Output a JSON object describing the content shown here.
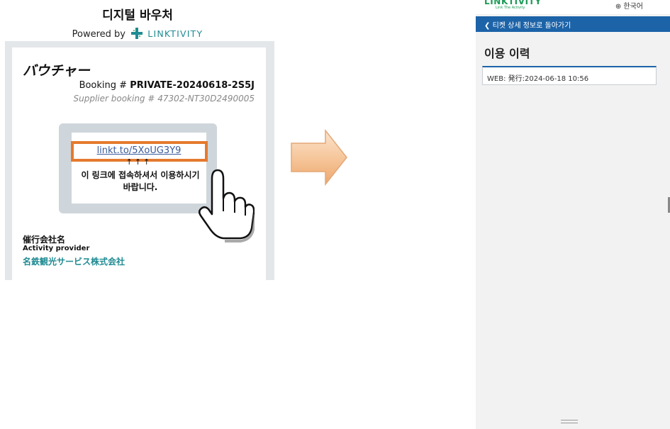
{
  "voucher": {
    "title": "디지털 바우처",
    "powered_by": "Powered by",
    "brand": "LINKTIVITY",
    "heading": "バウチャー",
    "booking_prefix": "Booking # ",
    "booking_number": "PRIVATE-20240618-2S5J",
    "supplier_booking": "Supplier booking # 47302-NT30D2490005",
    "link": "linkt.to/5XoUG3Y9",
    "arrows": "↑↑↑",
    "access_message": "이 링크에 접속하셔서 이용하시기 바랍니다.",
    "organizer_label": "催行会社名",
    "provider_label": "Activity provider",
    "provider_name": "名鉄観光サービス株式会社"
  },
  "phone": {
    "logo": "LINKTIVITY",
    "logo_tagline": "Link The Activity",
    "language": "한국어",
    "back_label": "티켓 상세 정보로 돌아가기",
    "history_title": "이용 이력",
    "history_entries": [
      "WEB: 発行:2024-06-18 10:56"
    ]
  },
  "colors": {
    "brand_teal": "#1f8b93",
    "highlight_orange": "#e57a2e",
    "nav_blue": "#1c63a8",
    "logo_green": "#1e9b57"
  },
  "icons": [
    "linktivity-logo-icon",
    "pointing-hand-icon",
    "right-arrow-icon",
    "globe-icon",
    "chevron-left-icon"
  ]
}
